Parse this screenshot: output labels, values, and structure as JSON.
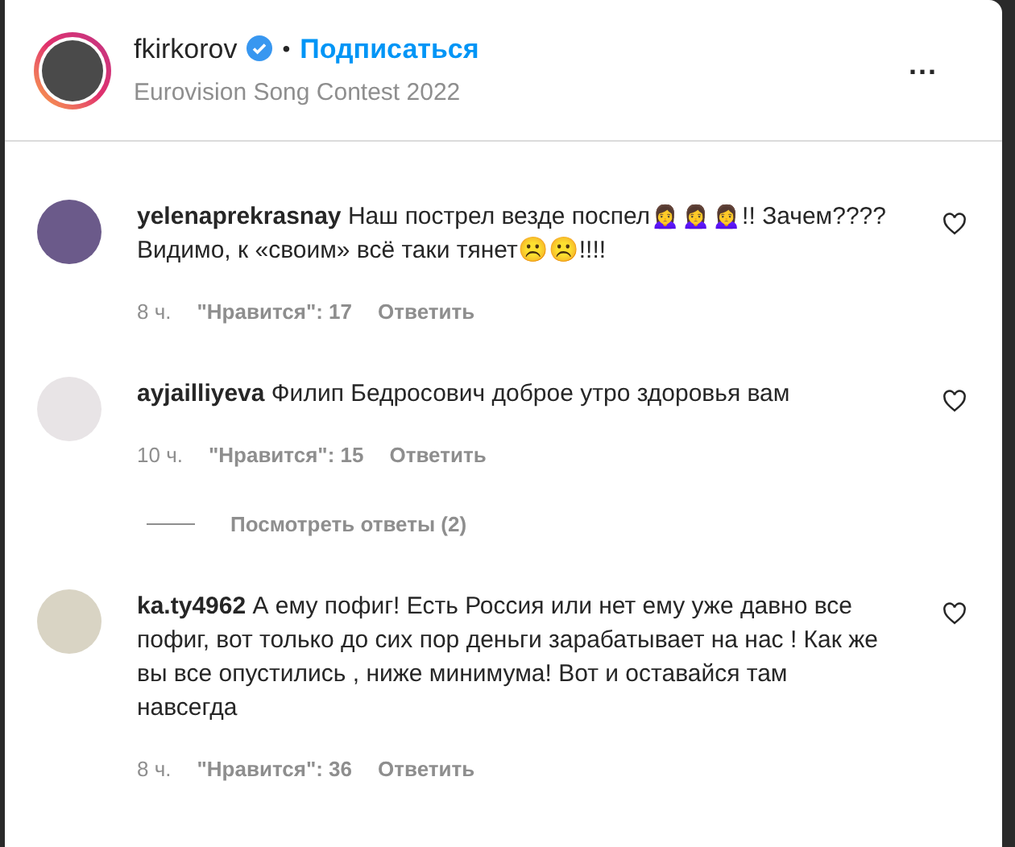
{
  "header": {
    "username": "fkirkorov",
    "verified": true,
    "separator": "•",
    "follow": "Подписаться",
    "subtitle": "Eurovision Song Contest 2022",
    "more": "..."
  },
  "comments": [
    {
      "username": "yelenaprekrasnay",
      "text": "Наш пострел везде поспел🙍‍♀️🙍‍♀️🙍‍♀️!! Зачем???? Видимо, к «своим» всё таки тянет☹️☹️!!!!",
      "time": "8 ч.",
      "likes": "\"Нравится\": 17",
      "reply": "Ответить",
      "liked": false
    },
    {
      "username": "ayjailliyeva",
      "text": "Филип Бедросович доброе утро здоровья вам",
      "time": "10 ч.",
      "likes": "\"Нравится\": 15",
      "reply": "Ответить",
      "liked": false,
      "view_replies": "Посмотреть ответы (2)"
    },
    {
      "username": "ka.ty4962",
      "text": "А ему пофиг! Есть Россия или нет ему уже давно все пофиг, вот только до сих пор деньги зарабатывает на нас ! Как же вы все опустились , ниже минимума! Вот и оставайся там навсегда",
      "time": "8 ч.",
      "likes": "\"Нравится\": 36",
      "reply": "Ответить",
      "liked": false
    }
  ]
}
